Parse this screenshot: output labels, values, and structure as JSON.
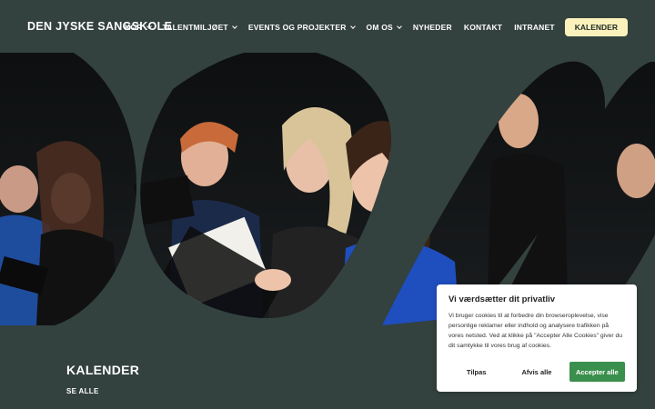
{
  "header": {
    "logo": "DEN JYSKE SANGSKOLE",
    "nav": [
      {
        "label": "KOR",
        "dropdown": true
      },
      {
        "label": "TALENTMILJØET",
        "dropdown": true
      },
      {
        "label": "EVENTS OG PROJEKTER",
        "dropdown": true
      },
      {
        "label": "OM OS",
        "dropdown": true
      },
      {
        "label": "NYHEDER",
        "dropdown": false
      },
      {
        "label": "KONTAKT",
        "dropdown": false
      },
      {
        "label": "INTRANET",
        "dropdown": false
      }
    ],
    "cta_label": "KALENDER"
  },
  "section": {
    "title": "KALENDER",
    "link": "SE ALLE"
  },
  "cookie": {
    "title": "Vi værdsætter dit privatliv",
    "text": "Vi bruger cookies til at forbedre din browseroplevelse, vise personlige reklamer eller indhold og analysere trafikken på vores netsted. Ved at klikke på \"Accepter Alle Cookies\" giver du dit samtykke til vores brug af cookies.",
    "customize_label": "Tilpas",
    "reject_label": "Afvis alle",
    "accept_label": "Accepter alle"
  },
  "colors": {
    "background": "#34423f",
    "cta": "#fbf2bb",
    "accept": "#3b8f4d"
  }
}
